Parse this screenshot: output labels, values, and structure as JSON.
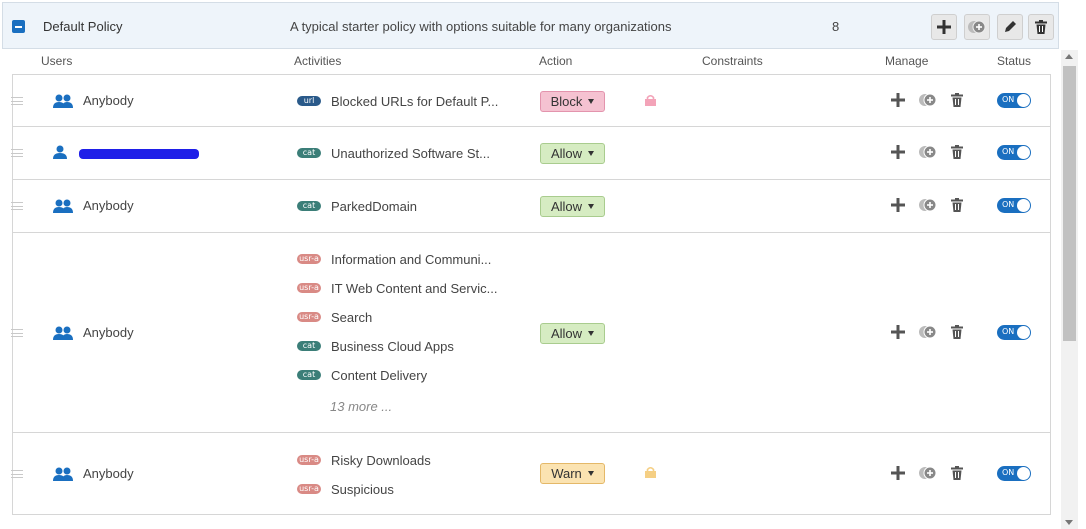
{
  "policy": {
    "name": "Default Policy",
    "description": "A typical starter policy with options suitable for many organizations",
    "rule_count": "8",
    "actions": [
      "add-icon",
      "clone-icon",
      "edit-icon",
      "delete-icon"
    ]
  },
  "columns": {
    "users": "Users",
    "activities": "Activities",
    "action": "Action",
    "constraints": "Constraints",
    "manage": "Manage",
    "status": "Status"
  },
  "rules": [
    {
      "user": "Anybody",
      "user_icon": "group-icon",
      "activities": [
        {
          "tag": "url",
          "label": "Blocked URLs for Default P..."
        }
      ],
      "action": "Block",
      "locked": true,
      "status": "ON"
    },
    {
      "user": "",
      "user_icon": "user-icon",
      "activities": [
        {
          "tag": "cat",
          "label": "Unauthorized Software St..."
        }
      ],
      "action": "Allow",
      "locked": false,
      "status": "ON"
    },
    {
      "user": "Anybody",
      "user_icon": "group-icon",
      "activities": [
        {
          "tag": "cat",
          "label": "ParkedDomain"
        }
      ],
      "action": "Allow",
      "locked": false,
      "status": "ON"
    },
    {
      "user": "Anybody",
      "user_icon": "group-icon",
      "activities": [
        {
          "tag": "usr-a",
          "label": "Information and Communi..."
        },
        {
          "tag": "usr-a",
          "label": "IT Web Content and Servic..."
        },
        {
          "tag": "usr-a",
          "label": "Search"
        },
        {
          "tag": "cat",
          "label": "Business Cloud Apps"
        },
        {
          "tag": "cat",
          "label": "Content Delivery"
        }
      ],
      "more": "13 more ...",
      "action": "Allow",
      "locked": false,
      "status": "ON"
    },
    {
      "user": "Anybody",
      "user_icon": "group-icon",
      "activities": [
        {
          "tag": "usr-a",
          "label": "Risky Downloads"
        },
        {
          "tag": "usr-a",
          "label": "Suspicious"
        }
      ],
      "action": "Warn",
      "locked": true,
      "status": "ON"
    }
  ],
  "colors": {
    "accent": "#1a6fc0",
    "block": "#f5c2d1",
    "allow": "#d6ecc2",
    "warn": "#fbe3b1"
  }
}
